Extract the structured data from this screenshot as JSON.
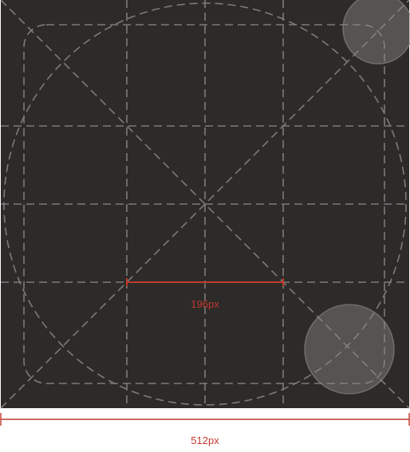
{
  "diagram": {
    "background_color": "#2d2b2a",
    "grid_line_color": "#7d7b7a",
    "circle_fill_color": "#8a8886",
    "measurement_color": "#c0392b",
    "canvas_size_label": "512px",
    "inner_span_label": "196px"
  }
}
